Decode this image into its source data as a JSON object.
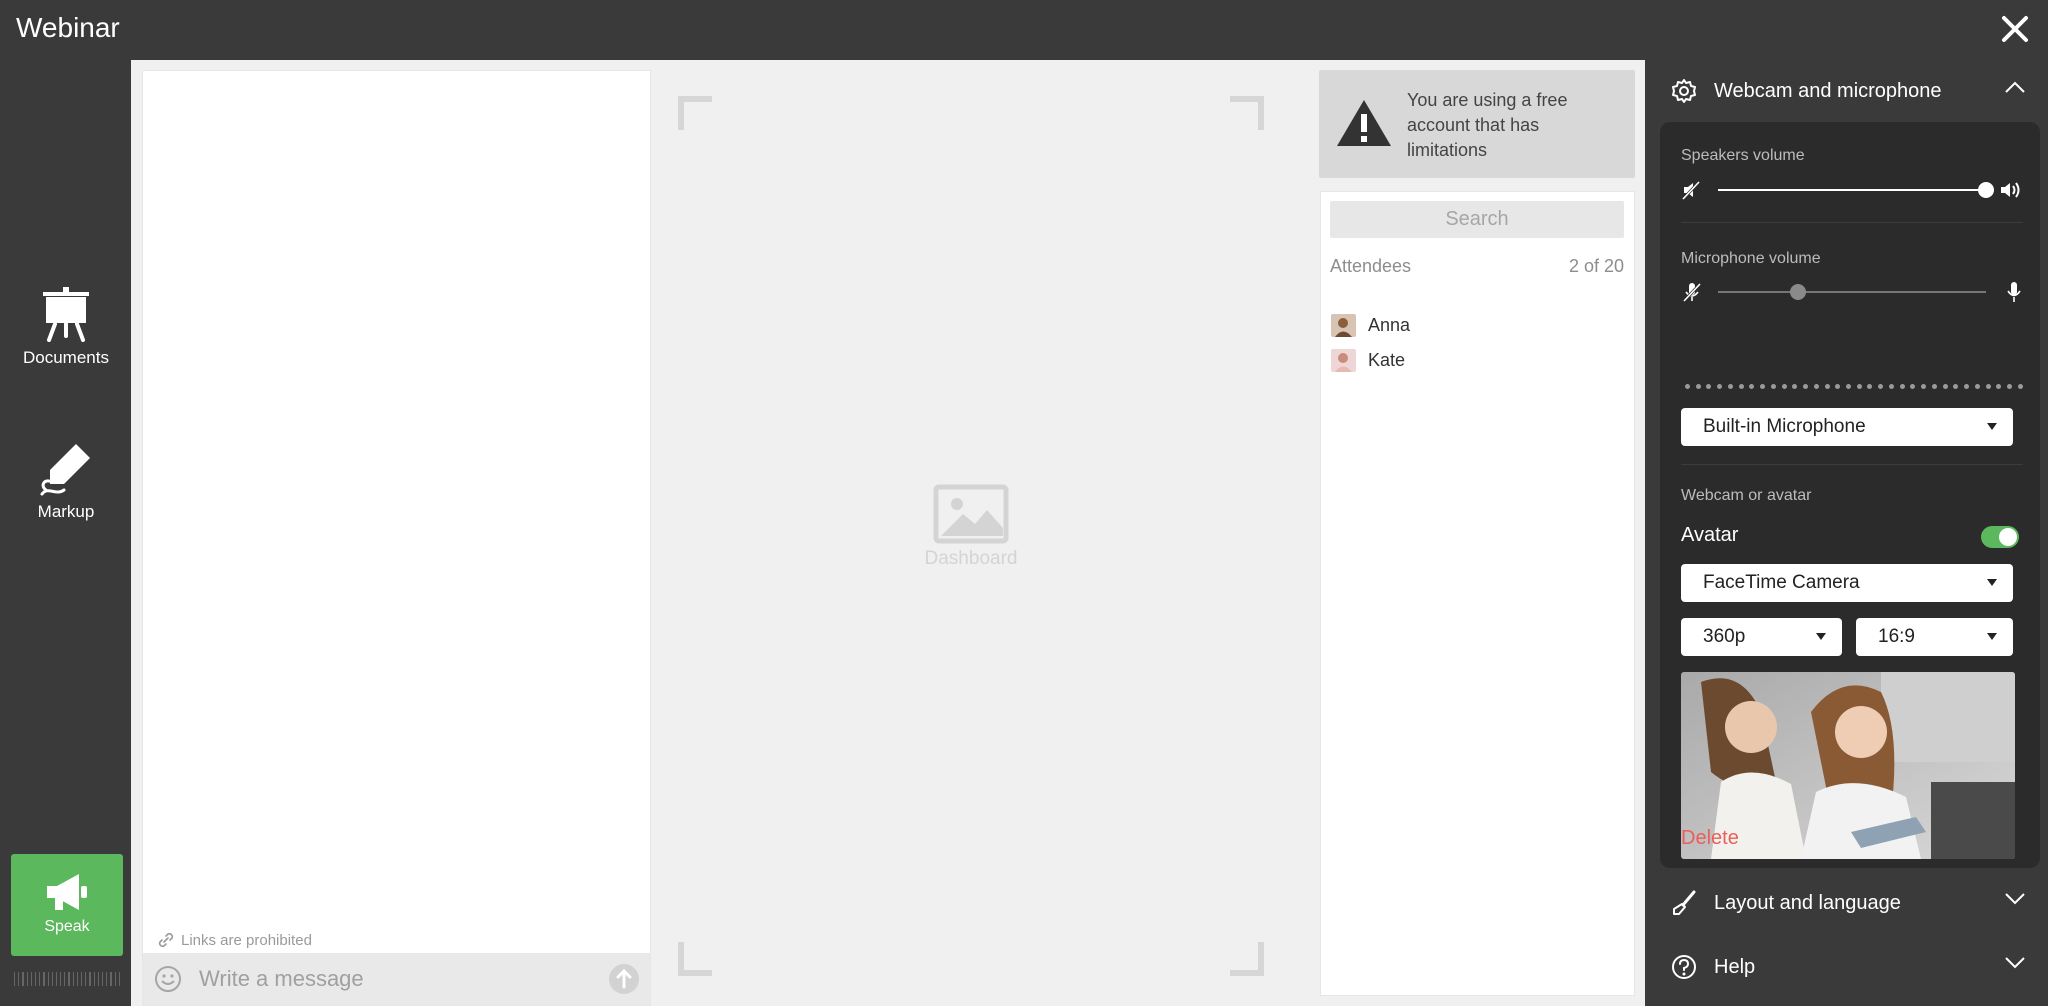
{
  "app": {
    "title": "Webinar"
  },
  "sidebar": {
    "documents_label": "Documents",
    "markup_label": "Markup",
    "speak_label": "Speak"
  },
  "chat": {
    "links_note": "Links are prohibited",
    "input_placeholder": "Write a message"
  },
  "dashboard": {
    "placeholder_label": "Dashboard"
  },
  "notice": {
    "text": "You are using a free account that has limitations"
  },
  "attendees": {
    "search_placeholder": "Search",
    "header_label": "Attendees",
    "count": "2 of 20",
    "list": [
      {
        "name": "Anna"
      },
      {
        "name": "Kate"
      }
    ]
  },
  "settings": {
    "webcam_section": {
      "title": "Webcam and microphone",
      "speakers_label": "Speakers volume",
      "speakers_level": 1.0,
      "microphone_label": "Microphone volume",
      "microphone_level": 0.3,
      "microphone_device": "Built-in Microphone",
      "webcam_label": "Webcam or avatar",
      "avatar_label": "Avatar",
      "avatar_enabled": true,
      "camera_device": "FaceTime Camera",
      "resolution": "360p",
      "aspect_ratio": "16:9",
      "delete_label": "Delete"
    },
    "layout_section": {
      "title": "Layout and language"
    },
    "help_section": {
      "title": "Help"
    }
  },
  "colors": {
    "accent_green": "#5cb85c",
    "delete_red": "#e8605a",
    "app_background": "#3a3a3a"
  }
}
